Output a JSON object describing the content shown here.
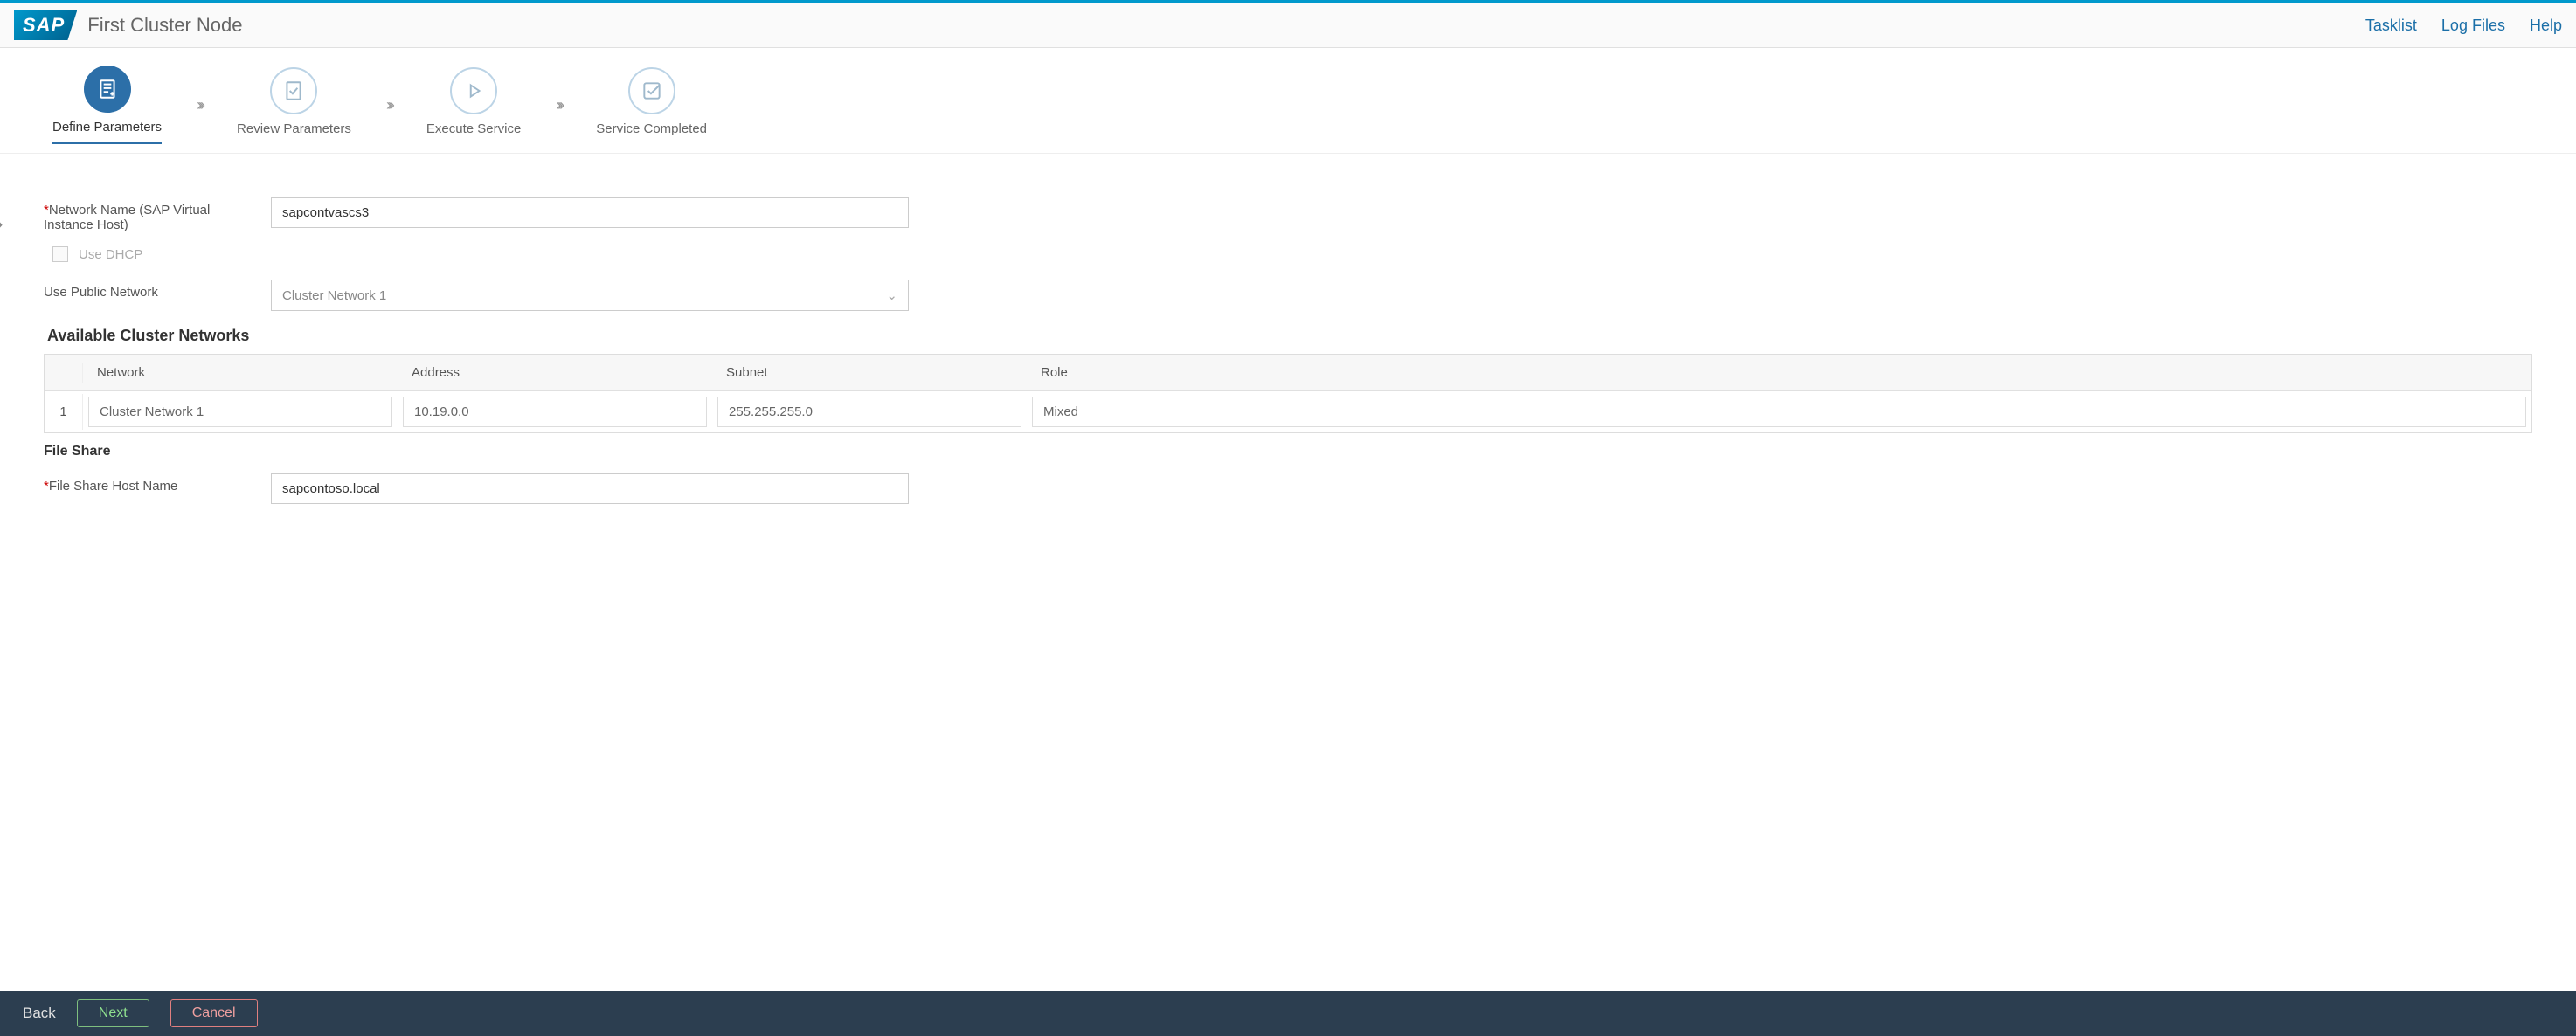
{
  "header": {
    "logo_text": "SAP",
    "title": "First Cluster Node",
    "links": {
      "tasklist": "Tasklist",
      "logfiles": "Log Files",
      "help": "Help"
    }
  },
  "wizard": {
    "steps": [
      {
        "label": "Define Parameters"
      },
      {
        "label": "Review Parameters"
      },
      {
        "label": "Execute Service"
      },
      {
        "label": "Service Completed"
      }
    ]
  },
  "form": {
    "network_name_label": "Network Name (SAP Virtual Instance Host)",
    "network_name_value": "sapcontvascs3",
    "use_dhcp_label": "Use DHCP",
    "use_public_network_label": "Use Public Network",
    "use_public_network_value": "Cluster Network 1",
    "available_networks_heading": "Available Cluster Networks",
    "table": {
      "headers": {
        "network": "Network",
        "address": "Address",
        "subnet": "Subnet",
        "role": "Role"
      },
      "rows": [
        {
          "idx": "1",
          "network": "Cluster Network 1",
          "address": "10.19.0.0",
          "subnet": "255.255.255.0",
          "role": "Mixed"
        }
      ]
    },
    "file_share_heading": "File Share",
    "file_share_host_label": "File Share Host Name",
    "file_share_host_value": "sapcontoso.local"
  },
  "footer": {
    "back": "Back",
    "next": "Next",
    "cancel": "Cancel"
  }
}
